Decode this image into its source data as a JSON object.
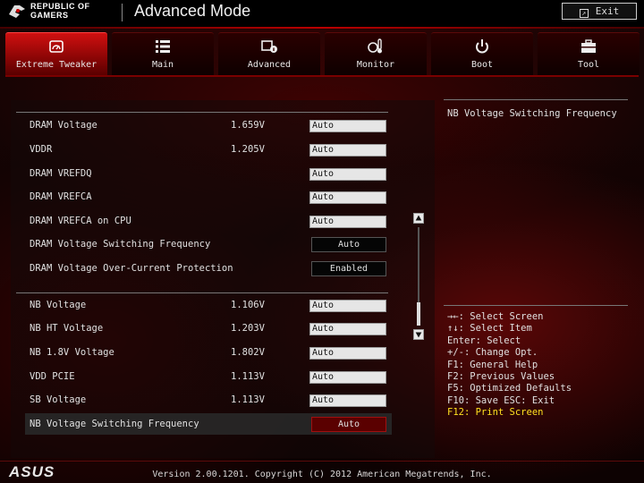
{
  "header": {
    "brand_line1": "REPUBLIC OF",
    "brand_line2": "GAMERS",
    "title": "Advanced Mode",
    "exit_label": "Exit"
  },
  "tabs": [
    {
      "label": "Extreme Tweaker",
      "icon": "gauge-icon",
      "active": true
    },
    {
      "label": "Main",
      "icon": "list-icon",
      "active": false
    },
    {
      "label": "Advanced",
      "icon": "chip-info-icon",
      "active": false
    },
    {
      "label": "Monitor",
      "icon": "thermometer-icon",
      "active": false
    },
    {
      "label": "Boot",
      "icon": "power-icon",
      "active": false
    },
    {
      "label": "Tool",
      "icon": "toolbox-icon",
      "active": false
    }
  ],
  "settings": [
    {
      "label": "DRAM Voltage",
      "value": "1.659V",
      "control": "Auto"
    },
    {
      "label": "VDDR",
      "value": "1.205V",
      "control": "Auto"
    },
    {
      "label": "DRAM VREFDQ",
      "value": "",
      "control": "Auto"
    },
    {
      "label": "DRAM VREFCA",
      "value": "",
      "control": "Auto"
    },
    {
      "label": "DRAM VREFCA on CPU",
      "value": "",
      "control": "Auto"
    },
    {
      "label": "DRAM Voltage Switching Frequency",
      "value": "",
      "control": "Auto"
    },
    {
      "label": "DRAM Voltage Over-Current Protection",
      "value": "",
      "control": "Enabled"
    },
    {
      "label": "NB Voltage",
      "value": "1.106V",
      "control": "Auto"
    },
    {
      "label": "NB HT Voltage",
      "value": "1.203V",
      "control": "Auto"
    },
    {
      "label": "NB 1.8V Voltage",
      "value": "1.802V",
      "control": "Auto"
    },
    {
      "label": "VDD PCIE",
      "value": "1.113V",
      "control": "Auto"
    },
    {
      "label": "SB Voltage",
      "value": "1.113V",
      "control": "Auto"
    },
    {
      "label": "NB Voltage Switching Frequency",
      "value": "",
      "control": "Auto"
    }
  ],
  "help": {
    "description": "NB Voltage Switching Frequency"
  },
  "keys": [
    "→←: Select Screen",
    "↑↓: Select Item",
    "Enter: Select",
    "+/-: Change Opt.",
    "F1: General Help",
    "F2: Previous Values",
    "F5: Optimized Defaults",
    "F10: Save  ESC: Exit",
    "F12: Print Screen"
  ],
  "footer": {
    "brand": "ASUS",
    "version": "Version 2.00.1201. Copyright (C) 2012 American Megatrends, Inc."
  },
  "colors": {
    "accent": "#d01010",
    "highlight_key": "#ffe020",
    "field_bg": "#e6e6e6"
  }
}
